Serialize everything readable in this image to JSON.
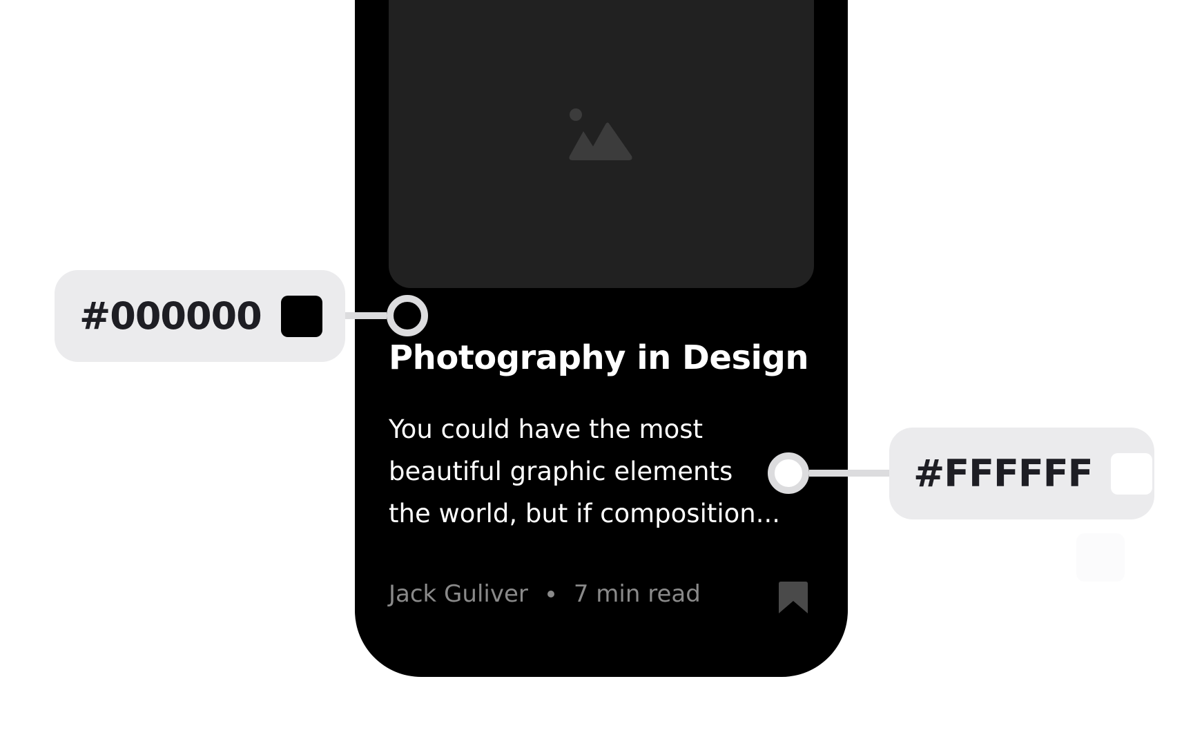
{
  "article": {
    "title": "Photography in Design",
    "excerpt_lines": [
      "You could have the most",
      "beautiful graphic elements",
      "the world, but if composition..."
    ],
    "author": "Jack Guliver",
    "read_time": "7 min read"
  },
  "annotations": {
    "background": {
      "code": "#000000",
      "swatch": "#000000"
    },
    "text": {
      "code": "#FFFFFF",
      "swatch": "#FFFFFF"
    }
  },
  "colors": {
    "card_background": "#000000",
    "image_placeholder": "#212121",
    "placeholder_icon": "#3C3C3C",
    "meta_text": "#8A8A8A",
    "bookmark": "#4A4A4A",
    "pill_background": "#EBEBED",
    "connector": "#DCDCDE"
  },
  "icons": {
    "placeholder": "image-icon",
    "bookmark": "bookmark-icon"
  }
}
